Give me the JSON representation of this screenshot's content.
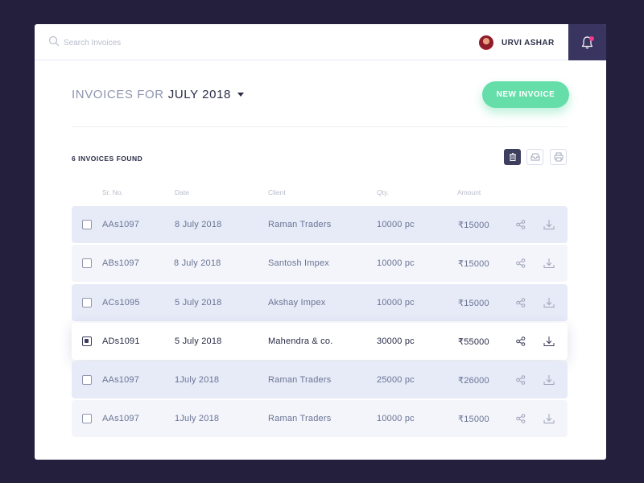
{
  "search": {
    "placeholder": "Search Invoices"
  },
  "user": {
    "name": "URVI ASHAR"
  },
  "header": {
    "title_prefix": "INVOICES FOR",
    "month": "JULY 2018",
    "new_invoice_label": "NEW INVOICE"
  },
  "summary": {
    "found_text": "6 INVOICES FOUND"
  },
  "table": {
    "columns": [
      "Sr. No.",
      "Date",
      "Client",
      "Qty.",
      "Amount"
    ],
    "rows": [
      {
        "sr": "AAs1097",
        "date": "8 July 2018",
        "client": "Raman Traders",
        "qty": "10000 pc",
        "amount": "₹15000",
        "checked": false
      },
      {
        "sr": "ABs1097",
        "date": "8 July 2018",
        "client": "Santosh Impex",
        "qty": "10000 pc",
        "amount": "₹15000",
        "checked": false
      },
      {
        "sr": "ACs1095",
        "date": "5 July 2018",
        "client": "Akshay Impex",
        "qty": "10000 pc",
        "amount": "₹15000",
        "checked": false
      },
      {
        "sr": "ADs1091",
        "date": "5 July 2018",
        "client": "Mahendra & co.",
        "qty": "30000 pc",
        "amount": "₹55000",
        "checked": true
      },
      {
        "sr": "AAs1097",
        "date": "1July 2018",
        "client": "Raman Traders",
        "qty": "25000 pc",
        "amount": "₹26000",
        "checked": false
      },
      {
        "sr": "AAs1097",
        "date": "1July 2018",
        "client": "Raman Traders",
        "qty": "10000 pc",
        "amount": "₹15000",
        "checked": false
      }
    ]
  },
  "colors": {
    "background": "#241f3d",
    "accent_green": "#66deaa",
    "notification_dot": "#f3388f",
    "bell_box": "#3a3460"
  },
  "icons": {
    "search": "search-icon",
    "bell": "bell-icon",
    "delete": "trash-icon",
    "archive": "inbox-icon",
    "print": "printer-icon",
    "share": "share-icon",
    "download": "download-icon"
  }
}
